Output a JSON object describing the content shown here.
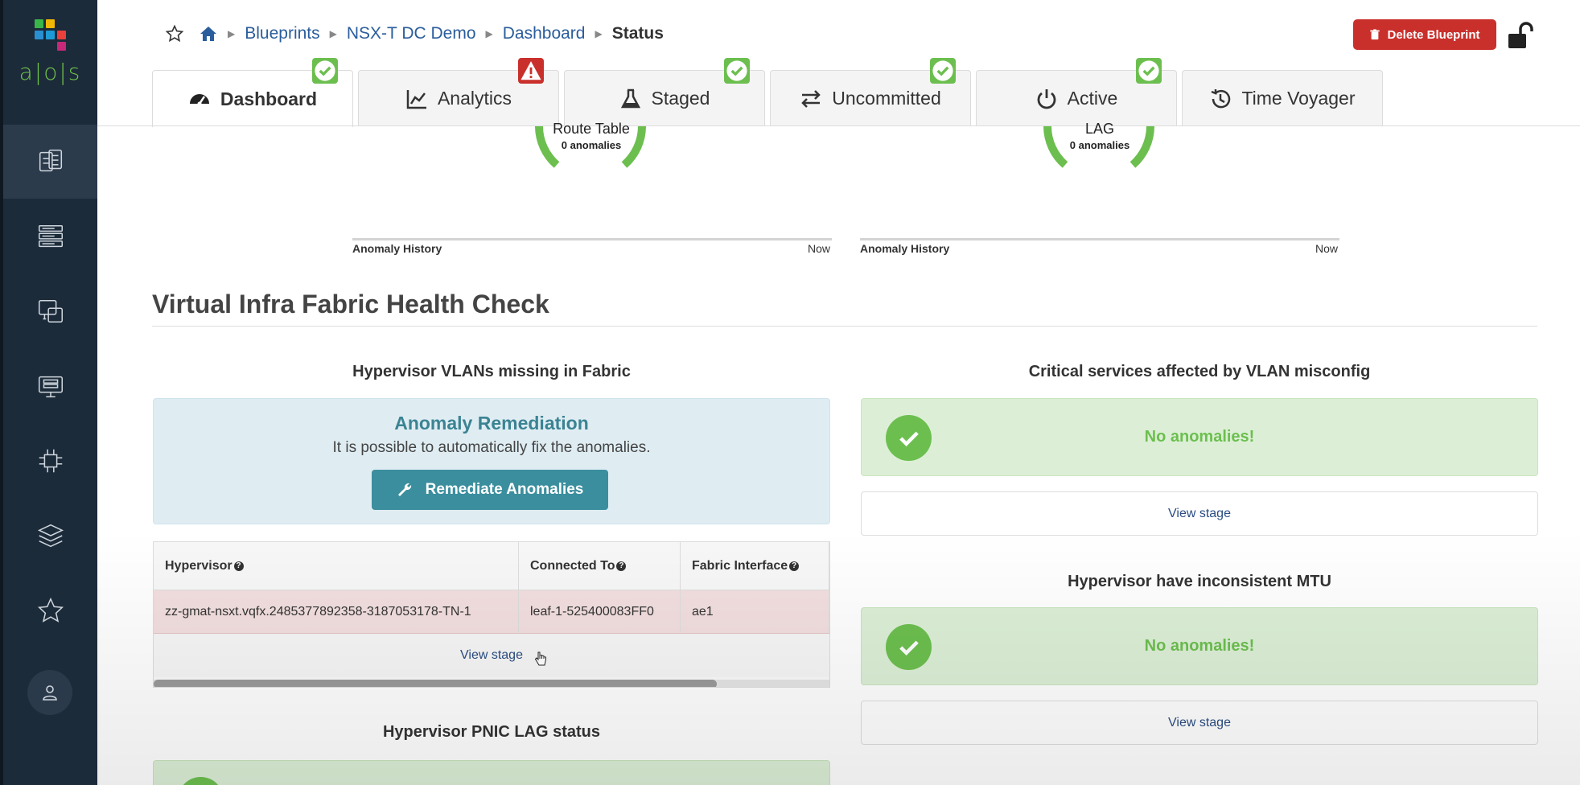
{
  "brand": {
    "logo_text": "a|o|s",
    "logo_colors": [
      "#3ab54a",
      "#f2b705",
      "#2a8fd1",
      "#1e9bd7",
      "#e8403a",
      "#c7287a",
      "#6fc04a"
    ]
  },
  "sidebar": {
    "items": [
      {
        "name": "blueprints",
        "icon": "blueprints-icon",
        "active": true
      },
      {
        "name": "devices",
        "icon": "devices-icon"
      },
      {
        "name": "design",
        "icon": "design-icon"
      },
      {
        "name": "resources",
        "icon": "resources-icon"
      },
      {
        "name": "external-systems",
        "icon": "external-systems-icon"
      },
      {
        "name": "platform",
        "icon": "layers-icon"
      },
      {
        "name": "favorites",
        "icon": "star-icon"
      },
      {
        "name": "user",
        "icon": "user-icon"
      }
    ]
  },
  "breadcrumb": {
    "items": [
      "Blueprints",
      "NSX-T DC Demo",
      "Dashboard"
    ],
    "current": "Status"
  },
  "header": {
    "delete_label": "Delete Blueprint"
  },
  "tabs": [
    {
      "label": "Dashboard",
      "icon": "speedometer-icon",
      "status": "ok",
      "active": true
    },
    {
      "label": "Analytics",
      "icon": "chart-icon",
      "status": "error"
    },
    {
      "label": "Staged",
      "icon": "flask-icon",
      "status": "ok"
    },
    {
      "label": "Uncommitted",
      "icon": "exchange-icon",
      "status": "ok"
    },
    {
      "label": "Active",
      "icon": "power-icon",
      "status": "ok"
    },
    {
      "label": "Time Voyager",
      "icon": "history-icon",
      "status": null
    }
  ],
  "gauges": [
    {
      "label": "Route Table",
      "sub": "0 anomalies",
      "history_label": "Anomaly History",
      "now_label": "Now"
    },
    {
      "label": "LAG",
      "sub": "0 anomalies",
      "history_label": "Anomaly History",
      "now_label": "Now"
    }
  ],
  "section": {
    "title": "Virtual Infra Fabric Health Check"
  },
  "vlans_panel": {
    "title": "Hypervisor VLANs missing in Fabric",
    "remediation_title": "Anomaly Remediation",
    "remediation_desc": "It is possible to automatically fix the anomalies.",
    "remediate_label": "Remediate Anomalies",
    "table": {
      "columns": [
        "Hypervisor",
        "Connected To",
        "Fabric Interface"
      ],
      "rows": [
        {
          "hypervisor": "zz-gmat-nsxt.vqfx.2485377892358-3187053178-TN-1",
          "connected_to": "leaf-1-525400083FF0",
          "fabric_interface": "ae1"
        }
      ]
    },
    "view_stage": "View stage"
  },
  "critical_panel": {
    "title": "Critical services affected by VLAN misconfig",
    "ok_text": "No anomalies!",
    "view_stage": "View stage"
  },
  "mtu_panel": {
    "title": "Hypervisor have inconsistent MTU",
    "ok_text": "No anomalies!",
    "view_stage": "View stage"
  },
  "pnic_panel": {
    "title": "Hypervisor PNIC LAG status"
  },
  "colors": {
    "sidebar": "#1c2b3a",
    "success": "#6cbf4f",
    "danger": "#c9302c",
    "teal": "#3b8e9e",
    "link": "#2a5d9c"
  }
}
